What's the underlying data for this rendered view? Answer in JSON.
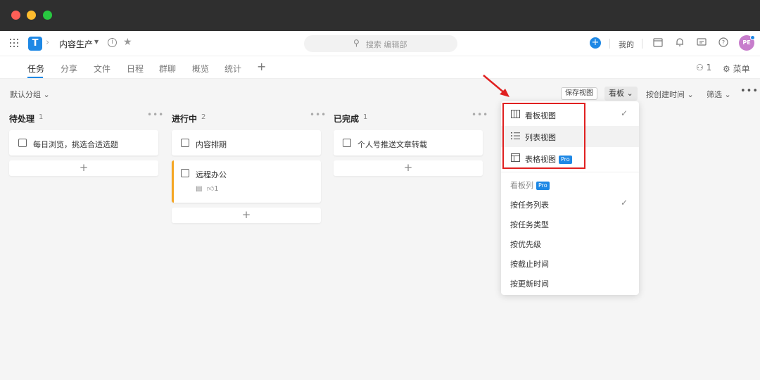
{
  "header": {
    "logo_letter": "T",
    "project_name": "内容生产",
    "search_placeholder": "搜索 编辑部",
    "mine_label": "我的",
    "avatar_initials": "PE"
  },
  "tabs": [
    {
      "label": "任务",
      "active": true
    },
    {
      "label": "分享"
    },
    {
      "label": "文件"
    },
    {
      "label": "日程"
    },
    {
      "label": "群聊"
    },
    {
      "label": "概览"
    },
    {
      "label": "统计"
    }
  ],
  "members_count": "1",
  "menu_label": "菜单",
  "toolbar": {
    "group_label": "默认分组",
    "save_view_label": "保存视图",
    "view_label": "看板",
    "sort_label": "按创建时间",
    "filter_label": "筛选"
  },
  "columns": [
    {
      "title": "待处理",
      "count": "1",
      "cards": [
        {
          "text": "每日浏览，挑选合适选题"
        }
      ]
    },
    {
      "title": "进行中",
      "count": "2",
      "cards": [
        {
          "text": "内容排期"
        },
        {
          "text": "远程办公",
          "likes": "1"
        }
      ]
    },
    {
      "title": "已完成",
      "count": "1",
      "cards": [
        {
          "text": "个人号推送文章转载"
        }
      ]
    }
  ],
  "view_menu": {
    "items": [
      {
        "label": "看板视图",
        "icon": "board-view-icon",
        "checked": true
      },
      {
        "label": "列表视图",
        "icon": "list-view-icon"
      },
      {
        "label": "表格视图",
        "icon": "table-view-icon",
        "badge": "Pro"
      }
    ],
    "section_label": "看板列",
    "section_badge": "Pro",
    "options": [
      {
        "label": "按任务列表",
        "checked": true
      },
      {
        "label": "按任务类型"
      },
      {
        "label": "按优先级"
      },
      {
        "label": "按截止时间"
      },
      {
        "label": "按更新时间"
      }
    ]
  },
  "colors": {
    "accent": "#1e88e5",
    "highlight_box": "#e02020",
    "in_progress_bar": "#f5a623"
  }
}
